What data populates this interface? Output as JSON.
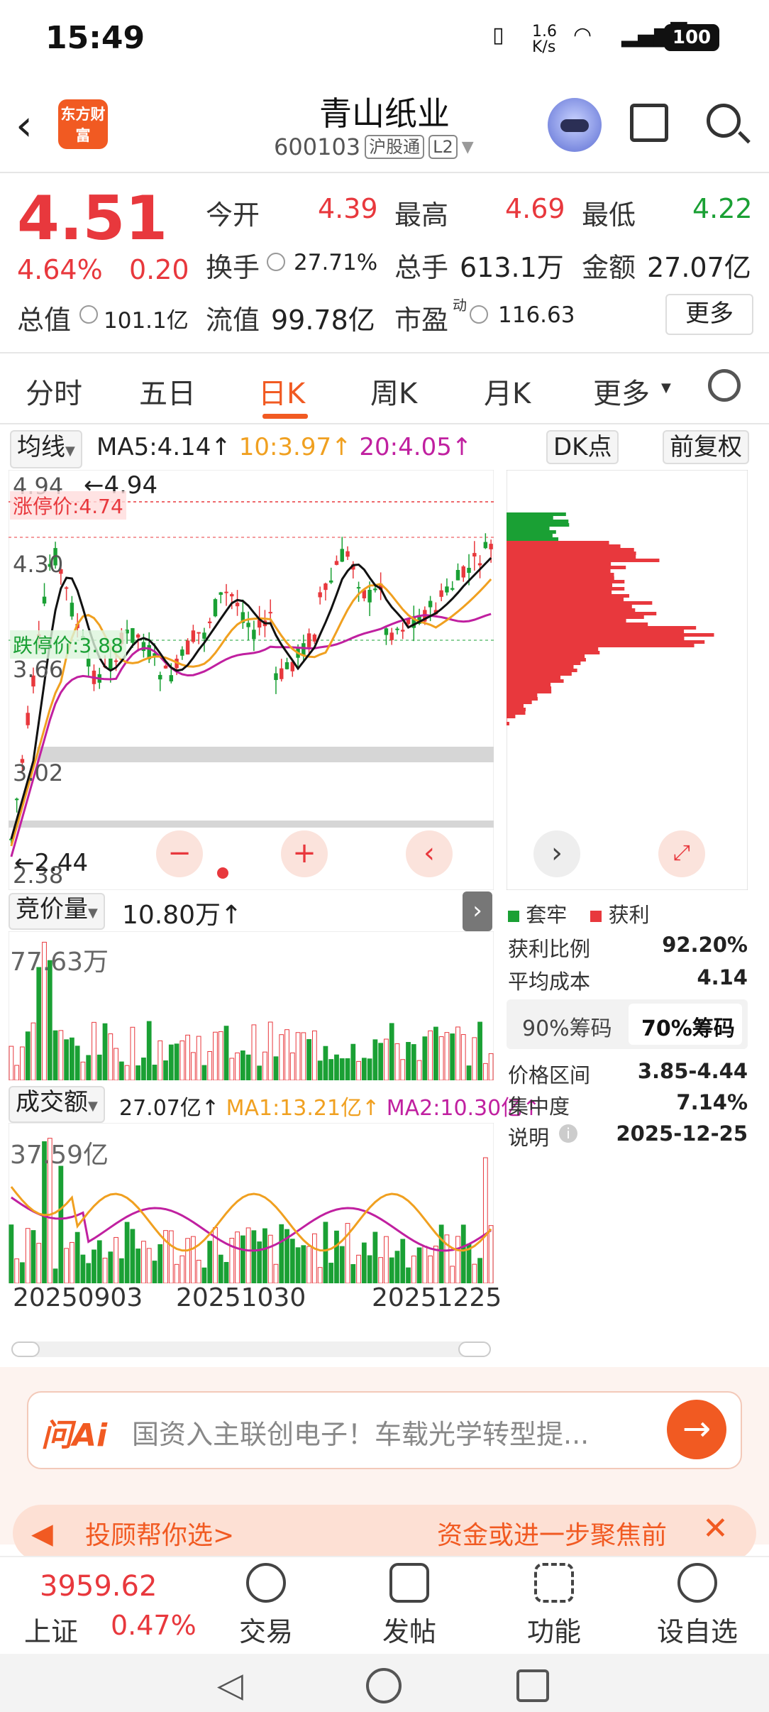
{
  "status_bar": {
    "time": "15:49",
    "net_speed": "1.6 K/s",
    "battery": "100"
  },
  "header": {
    "logo_text": "东方财富",
    "stock_name": "青山纸业",
    "stock_code": "600103",
    "tags": [
      "沪股通",
      "L2"
    ]
  },
  "quote": {
    "price": "4.51",
    "change_pct": "4.64%",
    "change": "0.20",
    "open_label": "今开",
    "open": "4.39",
    "high_label": "最高",
    "high": "4.69",
    "low_label": "最低",
    "low": "4.22",
    "turnover_label": "换手",
    "turnover": "27.71%",
    "volume_label": "总手",
    "volume": "613.1万",
    "amount_label": "金额",
    "amount": "27.07亿",
    "mktcap_label": "总值",
    "mktcap": "101.1亿",
    "float_label": "流值",
    "float": "99.78亿",
    "pe_label": "市盈",
    "pe_sup": "动",
    "pe": "116.63",
    "more_label": "更多"
  },
  "tabs": [
    "分时",
    "五日",
    "日K",
    "周K",
    "月K",
    "更多"
  ],
  "active_tab": "日K",
  "ma_bar": {
    "ma_label": "均线",
    "ma5": "MA5:4.14↑",
    "ma10": "10:3.97↑",
    "ma20": "20:4.05↑",
    "dk_label": "DK点",
    "adj_label": "前复权"
  },
  "kchart": {
    "y_ticks": [
      "4.94",
      "4.30",
      "3.66",
      "3.02",
      "2.38"
    ],
    "limit_up": "涨停价:4.74",
    "limit_down": "跌停价:3.88",
    "max_marker": "←4.94",
    "min_marker": "←2.44",
    "ctrl_minus": "−",
    "ctrl_plus": "+",
    "ctrl_left": "‹",
    "ctrl_right": "›"
  },
  "chip": {
    "legend_trapped": "套牢",
    "legend_profit": "获利",
    "profit_ratio_label": "获利比例",
    "profit_ratio": "92.20%",
    "avg_cost_label": "平均成本",
    "avg_cost": "4.14",
    "tab_90": "90%筹码",
    "tab_70": "70%筹码",
    "range_label": "价格区间",
    "range": "3.85-4.44",
    "concentration_label": "集中度",
    "concentration": "7.14%",
    "note_label": "说明",
    "note_date": "2025-12-25"
  },
  "volume_panel": {
    "label": "竞价量",
    "value": "10.80万↑",
    "max": "77.63万"
  },
  "amount_panel": {
    "label": "成交额",
    "value": "27.07亿↑",
    "ma1": "MA1:13.21亿↑",
    "ma2": "MA2:10.30亿↑",
    "max": "37.59亿",
    "dates": [
      "20250903",
      "20251030",
      "20251225"
    ]
  },
  "ask_ai": {
    "logo": "问Ai",
    "text": "国资入主联创电子！车载光学转型提..."
  },
  "ad": {
    "left": "投顾帮你选>",
    "right": "资金或进一步聚焦前"
  },
  "bottom_nav": {
    "index_value": "3959.62",
    "index_name": "上证",
    "index_pct": "0.47%",
    "items": [
      "交易",
      "发帖",
      "功能",
      "设自选"
    ]
  },
  "colors": {
    "up": "#e8383d",
    "down": "#1aa034",
    "accent": "#f15a22",
    "ma5": "#222222",
    "ma10": "#f0a020",
    "ma20": "#c020a0"
  }
}
